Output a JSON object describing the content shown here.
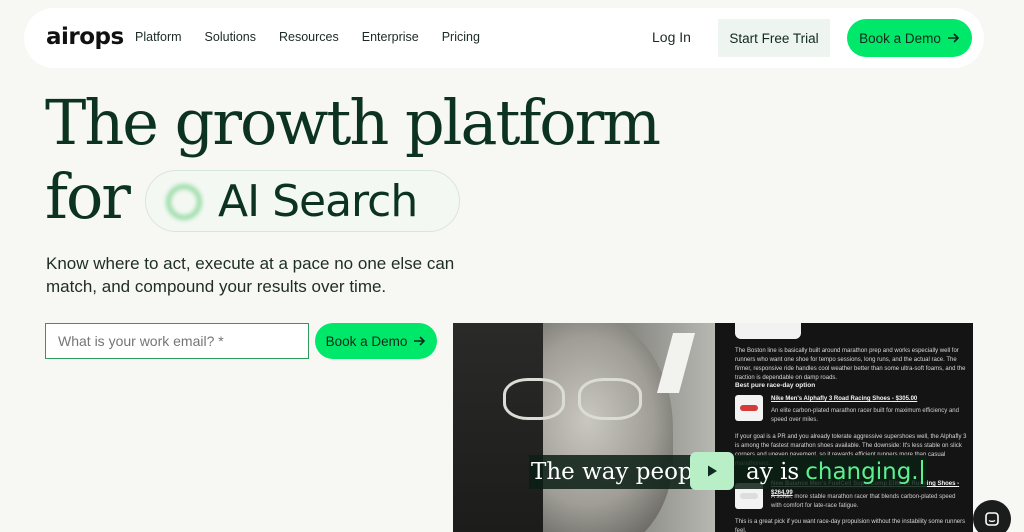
{
  "nav": {
    "logo": "airops",
    "items": [
      "Platform",
      "Solutions",
      "Resources",
      "Enterprise",
      "Pricing"
    ],
    "login": "Log In",
    "trial": "Start Free Trial",
    "demo": "Book a Demo"
  },
  "hero": {
    "line1": "The growth platform",
    "line2": "for",
    "pill": "AI Search",
    "subtitle": "Know where to act, execute at a pace no one else can match, and compound your results over time.",
    "email_placeholder": "What is your work email? *",
    "demo": "Book a Demo"
  },
  "video": {
    "caption_a": "The way peopl",
    "caption_b": "ay is",
    "caption_hl": "changing.",
    "panel": {
      "p1": "The Boston line is basically built around marathon prep and works especially well for runners who want one shoe for tempo sessions, long runs, and the actual race. The firmer, responsive ride handles cool weather better than some ultra-soft foams, and the traction is dependable on damp roads.",
      "h1": "Best pure race-day option",
      "link1": "Nike Men's Alphafly 3 Road Racing Shoes",
      "price1": "- $305.00",
      "d1": "An elite carbon-plated marathon racer built for maximum efficiency and speed over miles.",
      "p2": "If your goal is a PR and you already tolerate aggressive supershoes well, the Alphafly 3 is among the fastest marathon shoes available. The downside: It's less stable on slick corners and uneven pavement, so it rewards efficient runners more than casual marathoners.",
      "link2": "New Balance Men's FuelCell SuperComp Elite v5 Running Shoes",
      "price2": "- $264.99",
      "d2": "A softer, more stable marathon racer that blends carbon-plated speed with comfort for late-race fatigue.",
      "p3": "This is a great pick if you want race-day propulsion without the instability some runners feel."
    }
  },
  "colors": {
    "accent": "#00e86a",
    "heading": "#0b3320",
    "background": "#f7f7f3"
  }
}
